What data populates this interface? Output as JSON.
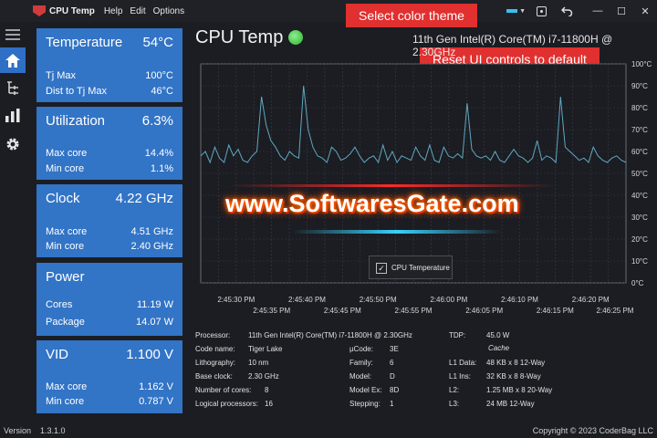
{
  "titlebar": {
    "app_name": "CPU Temp",
    "menu": [
      "Help",
      "Edit",
      "Options"
    ],
    "theme_color": "#38c0f0"
  },
  "tooltips": {
    "select_theme": "Select color theme",
    "reset_ui": "Reset UI controls to default"
  },
  "nav": [
    {
      "name": "menu",
      "icon": "hamburger-icon",
      "active": false
    },
    {
      "name": "home",
      "icon": "home-icon",
      "active": true
    },
    {
      "name": "tree",
      "icon": "tree-icon",
      "active": false
    },
    {
      "name": "charts",
      "icon": "bar-chart-icon",
      "active": false
    },
    {
      "name": "settings",
      "icon": "gear-icon",
      "active": false
    }
  ],
  "cards": {
    "temperature": {
      "title": "Temperature",
      "value": "54°C",
      "rows": [
        {
          "label": "Tj Max",
          "value": "100°C"
        },
        {
          "label": "Dist to Tj Max",
          "value": "46°C"
        }
      ]
    },
    "utilization": {
      "title": "Utilization",
      "value": "6.3%",
      "rows": [
        {
          "label": "Max core",
          "value": "14.4%"
        },
        {
          "label": "Min core",
          "value": "1.1%"
        }
      ]
    },
    "clock": {
      "title": "Clock",
      "value": "4.22 GHz",
      "rows": [
        {
          "label": "Max core",
          "value": "4.51 GHz"
        },
        {
          "label": "Min core",
          "value": "2.40 GHz"
        }
      ]
    },
    "power": {
      "title": "Power",
      "value": "",
      "rows": [
        {
          "label": "Cores",
          "value": "11.19 W"
        },
        {
          "label": "Package",
          "value": "14.07 W"
        }
      ]
    },
    "vid": {
      "title": "VID",
      "value": "1.100 V",
      "rows": [
        {
          "label": "Max core",
          "value": "1.162 V"
        },
        {
          "label": "Min core",
          "value": "0.787 V"
        }
      ]
    }
  },
  "main": {
    "title": "CPU Temp",
    "cpu_name": "11th Gen Intel(R) Core(TM) i7-11800H @ 2.30GHz"
  },
  "chart_data": {
    "type": "line",
    "series": [
      {
        "name": "CPU Temperature",
        "color": "#5fa8c2",
        "values": [
          58,
          60,
          55,
          62,
          57,
          55,
          63,
          58,
          61,
          56,
          55,
          58,
          60,
          85,
          72,
          65,
          62,
          58,
          56,
          60,
          58,
          57,
          90,
          70,
          62,
          58,
          57,
          55,
          62,
          60,
          56,
          57,
          59,
          62,
          58,
          55,
          57,
          58,
          55,
          63,
          56,
          60,
          55,
          58,
          57,
          56,
          62,
          58,
          56,
          63,
          56,
          55,
          62,
          58,
          57,
          59,
          57,
          82,
          61,
          58,
          57,
          58,
          56,
          60,
          56,
          55,
          58,
          61,
          58,
          57,
          55,
          57,
          65,
          56,
          58,
          57,
          55,
          85,
          62,
          60,
          58,
          56,
          57,
          55,
          62,
          58,
          56,
          55,
          57,
          58,
          56,
          55
        ]
      }
    ],
    "x_ticks_top": [
      "2:45:30 PM",
      "2:45:40 PM",
      "2:45:50 PM",
      "2:46:00 PM",
      "2:46:10 PM",
      "2:46:20 PM"
    ],
    "x_ticks_bottom": [
      "2:45:35 PM",
      "2:45:45 PM",
      "2:45:55 PM",
      "2:46:05 PM",
      "2:46:15 PM",
      "2:46:25 PM"
    ],
    "y_ticks": [
      "100°C",
      "90°C",
      "80°C",
      "70°C",
      "60°C",
      "50°C",
      "40°C",
      "30°C",
      "20°C",
      "10°C",
      "0°C"
    ],
    "ylim": [
      0,
      100
    ],
    "grid": true,
    "legend": {
      "label": "CPU Temperature",
      "checked": true,
      "placement": "bottom-center"
    }
  },
  "watermark": "www.SoftwaresGate.com",
  "specs": {
    "col1": [
      {
        "label": "Processor:",
        "value": "11th Gen Intel(R) Core(TM) i7-11800H @ 2.30GHz"
      },
      {
        "label": "Code name:",
        "value": "Tiger Lake"
      },
      {
        "label": "Lithography:",
        "value": "10 nm"
      },
      {
        "label": "Base clock:",
        "value": "2.30 GHz"
      },
      {
        "label": "Number of cores:",
        "value": "8"
      },
      {
        "label": "Logical processors:",
        "value": "16"
      }
    ],
    "col2": [
      {
        "label": "µCode:",
        "value": "3E"
      },
      {
        "label": "Family:",
        "value": "6"
      },
      {
        "label": "Model:",
        "value": "D"
      },
      {
        "label": "Model Ex:",
        "value": "8D"
      },
      {
        "label": "Stepping:",
        "value": "1"
      }
    ],
    "tdp": {
      "label": "TDP:",
      "value": "45.0 W"
    },
    "cache_header": "Cache",
    "cache": [
      {
        "label": "L1 Data:",
        "value": "48 KB x 8  12-Way"
      },
      {
        "label": "L1 Ins:",
        "value": "32 KB x 8  8-Way"
      },
      {
        "label": "L2:",
        "value": "1.25 MB x 8  20-Way"
      },
      {
        "label": "L3:",
        "value": "24 MB  12-Way"
      }
    ]
  },
  "statusbar": {
    "version_label": "Version",
    "version": "1.3.1.0",
    "copyright": "Copyright © 2023 CoderBag LLC"
  }
}
